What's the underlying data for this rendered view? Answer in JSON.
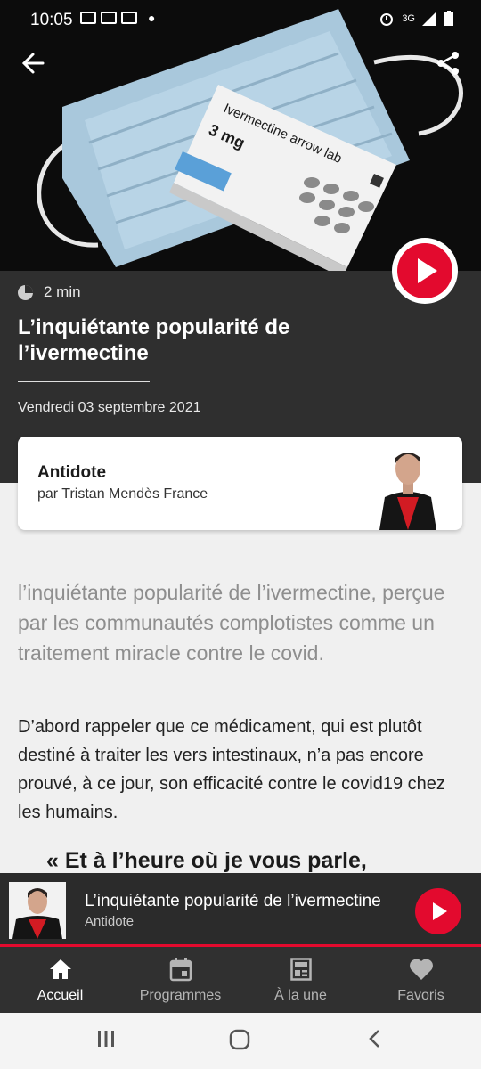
{
  "status_bar": {
    "time": "10:05",
    "network": "3G"
  },
  "article": {
    "duration": "2 min",
    "title": "L’inquiétante popularité de l’ivermectine",
    "date": "Vendredi 03 septembre 2021",
    "hero_box_text": "Ivermectine arrow lab",
    "hero_box_dose": "3 mg"
  },
  "show": {
    "name": "Antidote",
    "byline": "par Tristan Mendès France"
  },
  "body": {
    "lead": "l’inquiétante popularité de l’ivermectine, perçue par les communautés complotistes comme un traitement miracle contre le covid.",
    "paragraph": "D’abord rappeler que ce médicament, qui est plutôt destiné à traiter les vers intestinaux, n’a pas encore prouvé, à ce jour, son efficacité contre le covid19 chez les humains.",
    "quote": "«  Et à l’heure où je vous parle,"
  },
  "mini_player": {
    "title": "L’inquiétante popularité de l’ivermectine",
    "subtitle": "Antidote"
  },
  "nav": {
    "items": [
      {
        "label": "Accueil",
        "icon": "home-icon",
        "active": true
      },
      {
        "label": "Programmes",
        "icon": "calendar-icon",
        "active": false
      },
      {
        "label": "À la une",
        "icon": "news-icon",
        "active": false
      },
      {
        "label": "Favoris",
        "icon": "heart-icon",
        "active": false
      }
    ]
  },
  "colors": {
    "accent": "#e30a2e",
    "header_bg": "#2f2f2f",
    "page_bg": "#f0f0f0"
  }
}
